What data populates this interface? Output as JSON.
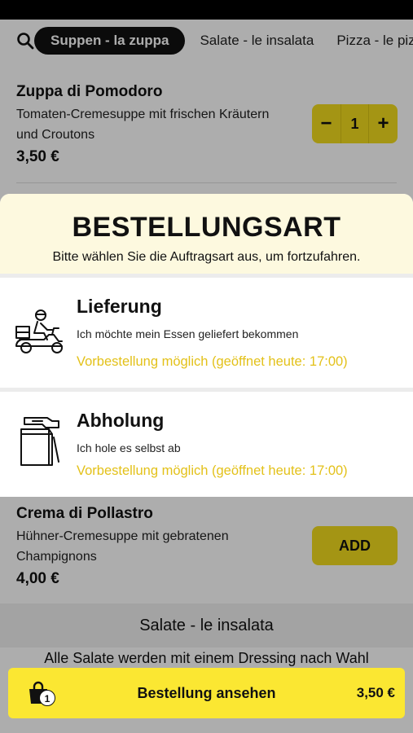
{
  "categories": [
    {
      "label": "Suppen - la zuppa",
      "active": true
    },
    {
      "label": "Salate - le insalata",
      "active": false
    },
    {
      "label": "Pizza - le pizze",
      "active": false
    }
  ],
  "items": [
    {
      "name": "Zuppa di Pomodoro",
      "description": "Tomaten-Cremesuppe mit frischen Kräutern und Croutons",
      "price": "3,50 €",
      "quantity": "1",
      "minus": "−",
      "plus": "+"
    },
    {
      "name": "Crema di Pollastro",
      "description": "Hühner-Cremesuppe mit gebratenen Champignons",
      "price": "4,00 €",
      "add_label": "ADD"
    }
  ],
  "section": {
    "title": "Salate - le insalata",
    "subtitle": "Alle Salate werden mit einem Dressing nach Wahl"
  },
  "order_type": {
    "title": "BESTELLUNGSART",
    "subtitle": "Bitte wählen Sie die Auftragsart aus, um fortzufahren.",
    "options": [
      {
        "title": "Lieferung",
        "description": "Ich möchte mein Essen geliefert bekommen",
        "note": "Vorbestellung möglich (geöffnet heute: 17:00)",
        "icon": "delivery-scooter-icon"
      },
      {
        "title": "Abholung",
        "description": "Ich hole es selbst ab",
        "note": "Vorbestellung möglich (geöffnet heute: 17:00)",
        "icon": "pickup-bag-icon"
      }
    ]
  },
  "cart": {
    "label": "Bestellung ansehen",
    "count": "1",
    "total": "3,50 €"
  },
  "colors": {
    "accent": "#f2dc1e",
    "cart": "#fbe732",
    "note": "#e3c119",
    "sheet_header": "#fdf9df"
  }
}
